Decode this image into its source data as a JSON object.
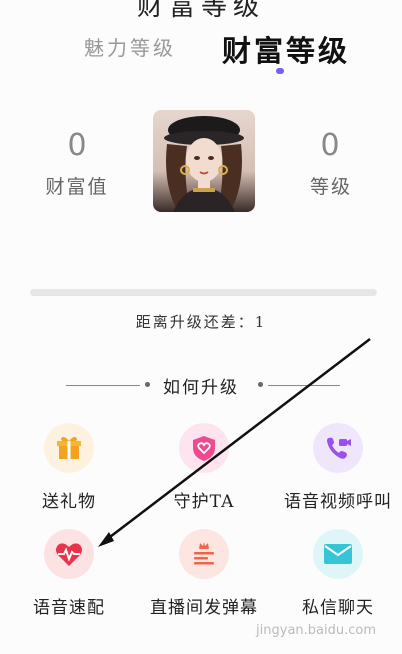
{
  "header": {
    "title_partial": "财富等级",
    "tabs": [
      {
        "label": "魅力等级",
        "active": false
      },
      {
        "label": "财富等级",
        "active": true
      }
    ],
    "active_color": "#7b5cf5"
  },
  "stats": {
    "wealth_value": "0",
    "wealth_label": "财富值",
    "level_value": "0",
    "level_label": "等级"
  },
  "progress": {
    "fraction": 0.0,
    "remaining_text": "距离升级还差：1"
  },
  "howto": {
    "title": "如何升级"
  },
  "features": [
    {
      "label": "送礼物",
      "icon": "gift-icon",
      "bg": "#fdf2e0",
      "color": "#f3a321"
    },
    {
      "label": "守护TA",
      "icon": "shield-heart-icon",
      "bg": "#fde4ef",
      "color": "#ec4c8f"
    },
    {
      "label": "语音视频呼叫",
      "icon": "video-call-icon",
      "bg": "#f0e6fb",
      "color": "#9a4ff0"
    },
    {
      "label": "语音速配",
      "icon": "heartbeat-icon",
      "bg": "#fde2e4",
      "color": "#e8334a"
    },
    {
      "label": "直播间发弹幕",
      "icon": "crown-danmaku-icon",
      "bg": "#fde6e1",
      "color": "#f0654a"
    },
    {
      "label": "私信聊天",
      "icon": "mail-icon",
      "bg": "#dff6f8",
      "color": "#36c5d8"
    }
  ],
  "watermark": "jingyan.baidu.com"
}
